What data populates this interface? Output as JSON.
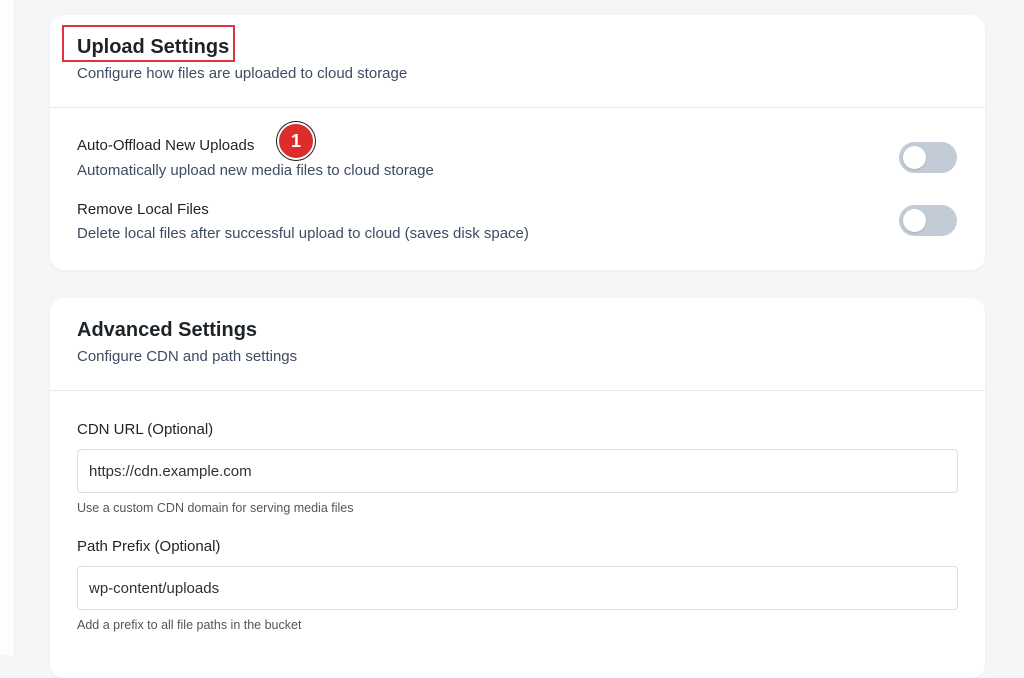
{
  "upload_settings": {
    "title": "Upload Settings",
    "subtitle": "Configure how files are uploaded to cloud storage",
    "annotation_badge": "1",
    "settings": [
      {
        "label": "Auto-Offload New Uploads",
        "description": "Automatically upload new media files to cloud storage",
        "enabled": false
      },
      {
        "label": "Remove Local Files",
        "description": "Delete local files after successful upload to cloud (saves disk space)",
        "enabled": false
      }
    ]
  },
  "advanced_settings": {
    "title": "Advanced Settings",
    "subtitle": "Configure CDN and path settings",
    "cdn_url": {
      "label": "CDN URL (Optional)",
      "value": "https://cdn.example.com",
      "help": "Use a custom CDN domain for serving media files"
    },
    "path_prefix": {
      "label": "Path Prefix (Optional)",
      "value": "wp-content/uploads",
      "help": "Add a prefix to all file paths in the bucket"
    }
  },
  "colors": {
    "highlight": "#e0323a",
    "badge": "#dd2c2c",
    "toggle_off": "#c3cbd6"
  }
}
